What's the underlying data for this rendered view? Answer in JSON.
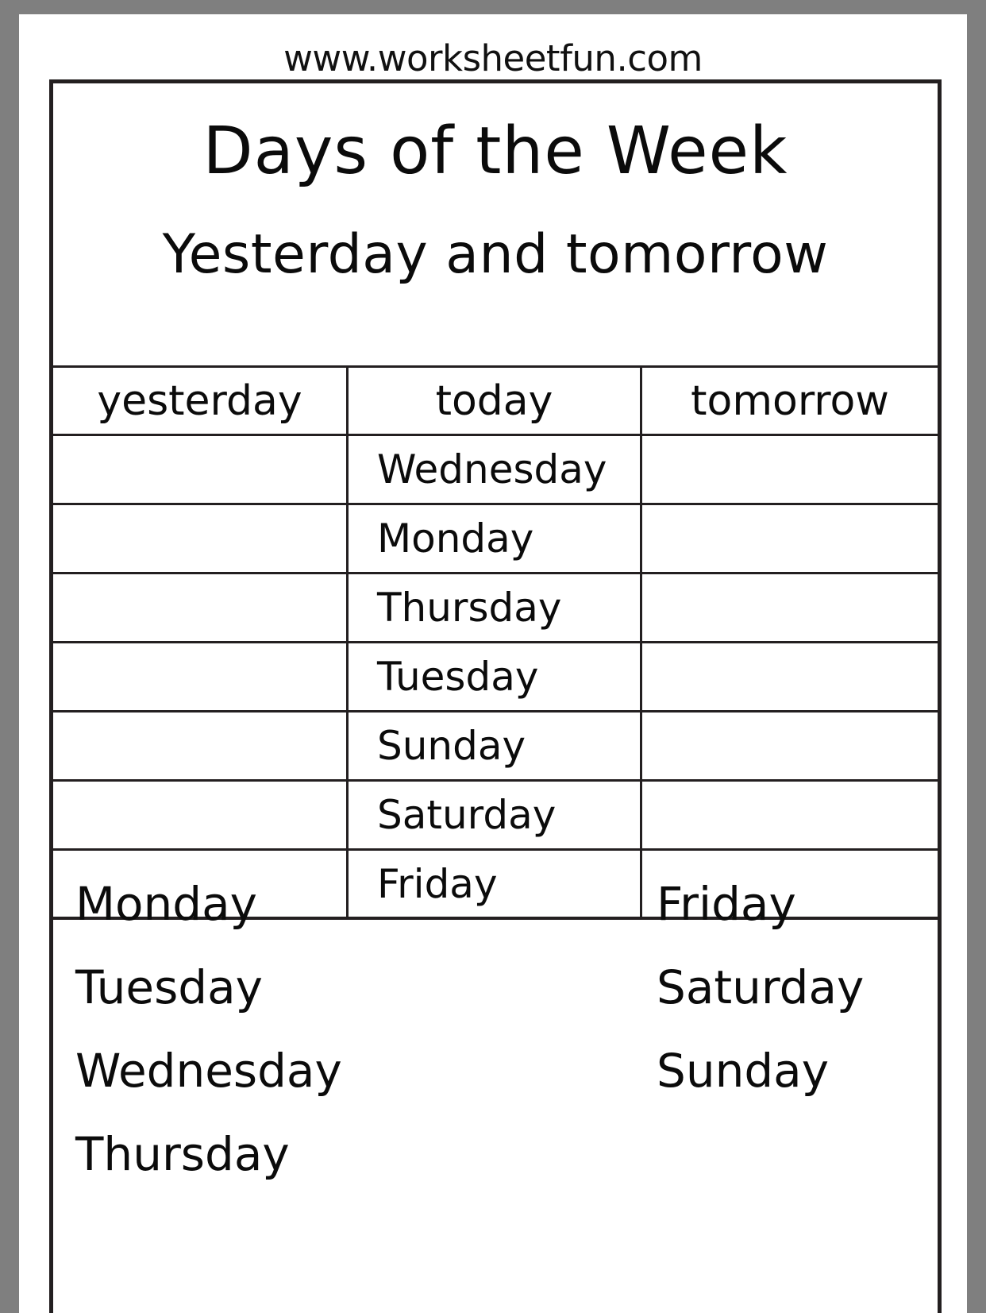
{
  "page": {
    "site_url": "www.worksheetfun.com",
    "title": "Days of the Week",
    "subtitle": "Yesterday and tomorrow"
  },
  "table": {
    "columns": [
      {
        "key": "yesterday",
        "header": "yesterday"
      },
      {
        "key": "today",
        "header": "today"
      },
      {
        "key": "tomorrow",
        "header": "tomorrow"
      }
    ],
    "rows": [
      {
        "yesterday": "",
        "today": "Wednesday",
        "tomorrow": ""
      },
      {
        "yesterday": "",
        "today": "Monday",
        "tomorrow": ""
      },
      {
        "yesterday": "",
        "today": "Thursday",
        "tomorrow": ""
      },
      {
        "yesterday": "",
        "today": "Tuesday",
        "tomorrow": ""
      },
      {
        "yesterday": "",
        "today": "Sunday",
        "tomorrow": ""
      },
      {
        "yesterday": "",
        "today": "Saturday",
        "tomorrow": ""
      },
      {
        "yesterday": "",
        "today": "Friday",
        "tomorrow": ""
      }
    ]
  },
  "word_bank": {
    "left_column": [
      "Monday",
      "Tuesday",
      "Wednesday",
      "Thursday"
    ],
    "right_column": [
      "Friday",
      "Saturday",
      "Sunday"
    ]
  },
  "colors": {
    "matte": "#7f7f7f",
    "paper": "#ffffff",
    "ink": "#0b0b0b",
    "rule": "#231f20"
  }
}
